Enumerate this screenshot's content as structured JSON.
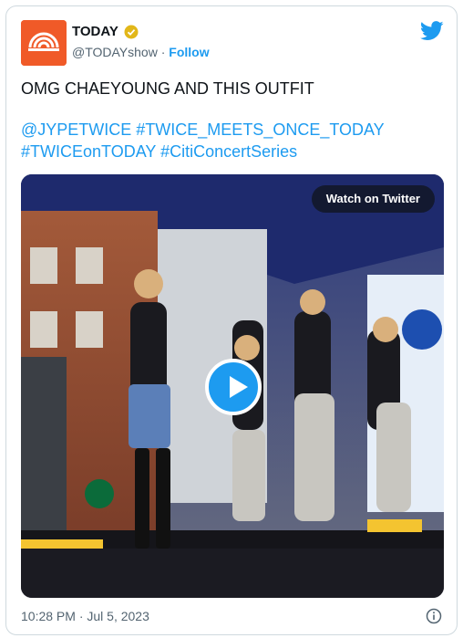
{
  "account": {
    "name": "TODAY",
    "handle": "@TODAYshow",
    "separator": "·",
    "follow_label": "Follow"
  },
  "tweet": {
    "line1": "OMG CHAEYOUNG AND THIS OUTFIT",
    "link1": "@JYPETWICE",
    "link2": "#TWICE_MEETS_ONCE_TODAY",
    "link3": "#TWICEonTODAY",
    "link4": "#CitiConcertSeries"
  },
  "media": {
    "watch_label": "Watch on Twitter"
  },
  "footer": {
    "timestamp": "10:28 PM · Jul 5, 2023"
  },
  "colors": {
    "accent": "#1d9bf0",
    "brand": "#f05a28"
  },
  "icons": [
    "today-logo-icon",
    "verified-badge-icon",
    "twitter-bird-icon",
    "play-icon",
    "info-icon"
  ]
}
